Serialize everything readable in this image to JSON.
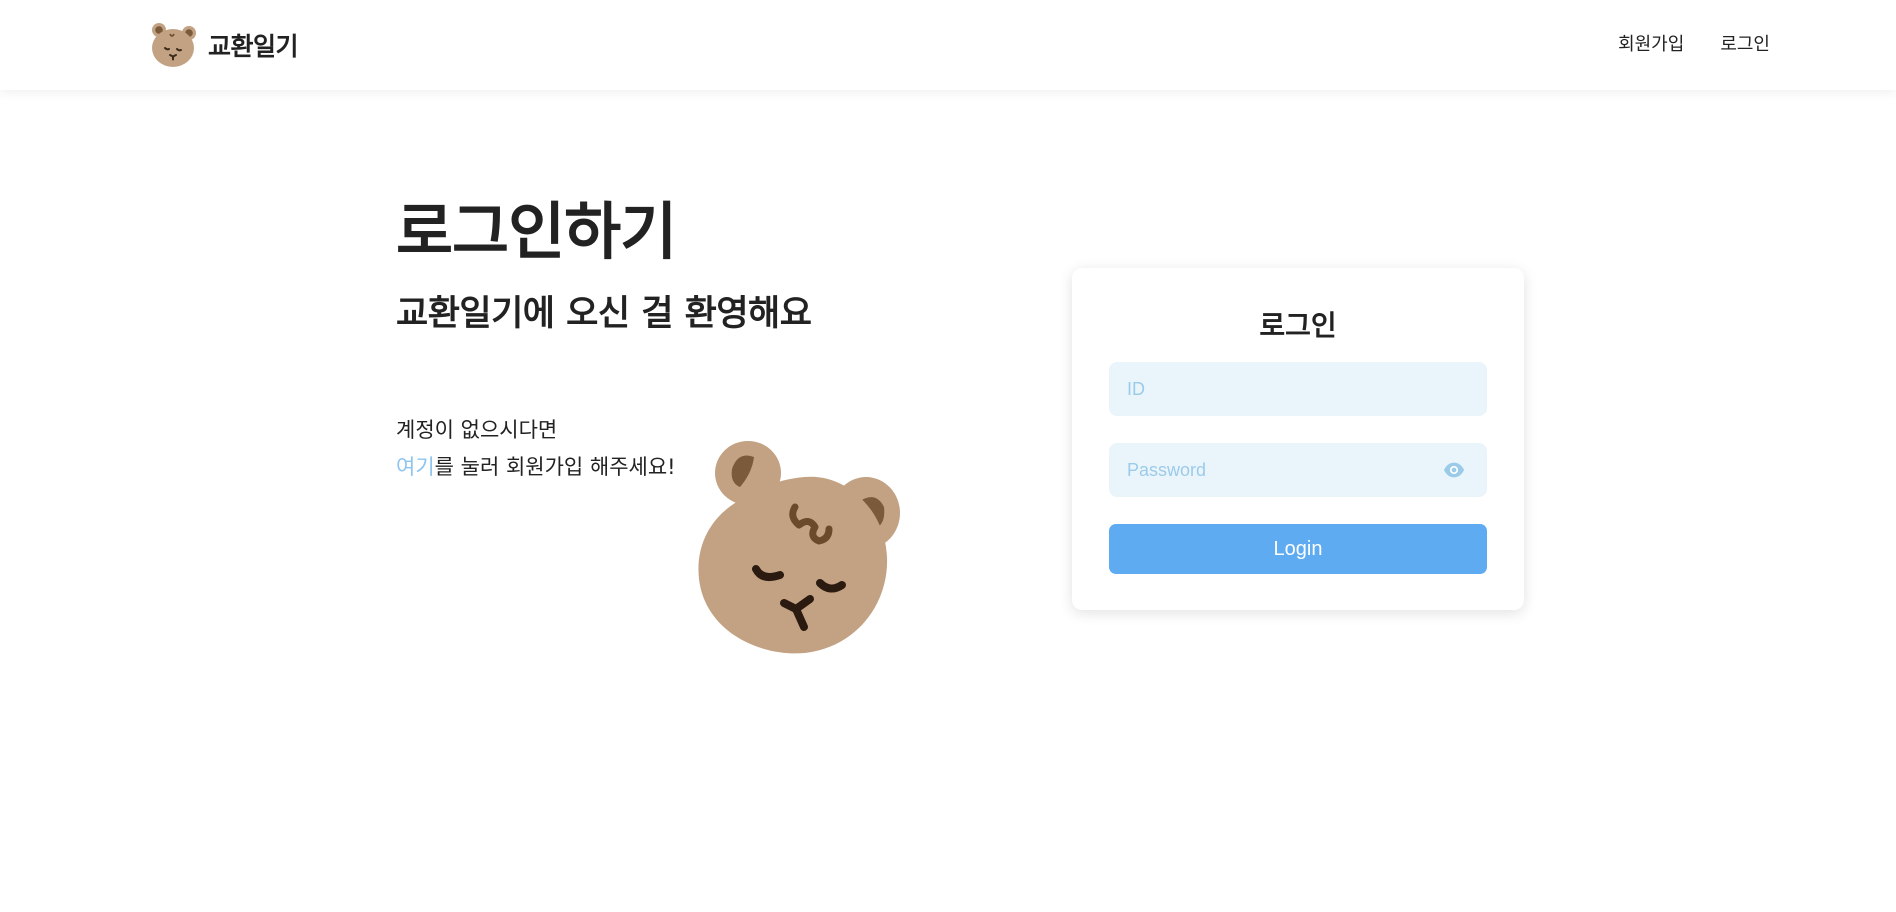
{
  "header": {
    "logo_text": "교환일기",
    "nav": {
      "signup": "회원가입",
      "login": "로그인"
    }
  },
  "hero": {
    "title": "로그인하기",
    "subtitle": "교환일기에 오신 걸 환영해요",
    "hint_line1": "계정이 없으시다면",
    "hint_link": "여기",
    "hint_rest": "를 눌러 회원가입 해주세요!"
  },
  "login_card": {
    "title": "로그인",
    "id_placeholder": "ID",
    "password_placeholder": "Password",
    "submit_label": "Login"
  },
  "icons": {
    "logo": "bear-face-icon",
    "password_toggle": "eye-icon"
  },
  "colors": {
    "accent": "#5fabf2",
    "link": "#8ec5f0",
    "input_bg": "#eaf5fb",
    "bear": "#c3a283"
  }
}
